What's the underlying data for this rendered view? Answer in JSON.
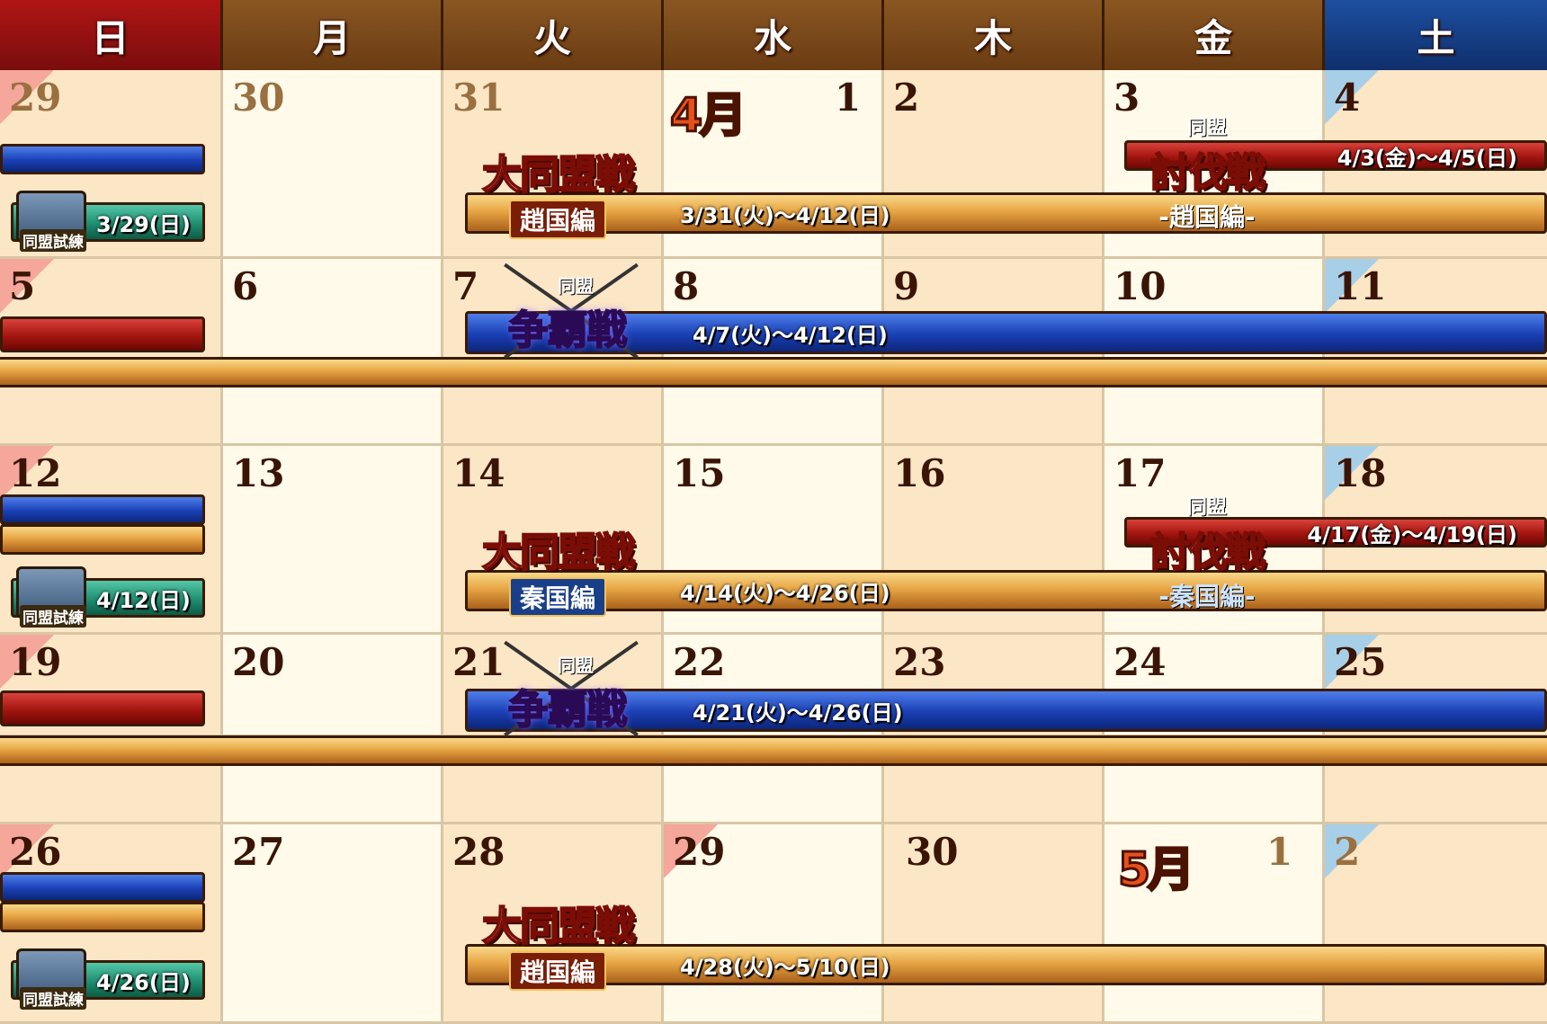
{
  "header": {
    "days": [
      "日",
      "月",
      "火",
      "水",
      "木",
      "金",
      "土"
    ]
  },
  "month_labels": {
    "april": "4月",
    "may": "5月"
  },
  "weeks": [
    {
      "dates": [
        "29",
        "30",
        "31",
        "1",
        "2",
        "3",
        "4"
      ]
    },
    {
      "dates": [
        "5",
        "6",
        "7",
        "8",
        "9",
        "10",
        "11"
      ]
    },
    {
      "dates": [
        "12",
        "13",
        "14",
        "15",
        "16",
        "17",
        "18"
      ]
    },
    {
      "dates": [
        "19",
        "20",
        "21",
        "22",
        "23",
        "24",
        "25"
      ]
    },
    {
      "dates": [
        "26",
        "27",
        "28",
        "29",
        "30",
        "1",
        "2"
      ]
    }
  ],
  "events": {
    "daidoumei_1": {
      "title": "大同盟戦",
      "sub": "趙国編",
      "dates": "3/31(火)～4/12(日)"
    },
    "daidoumei_2": {
      "title": "大同盟戦",
      "sub": "秦国編",
      "dates": "4/14(火)～4/26(日)"
    },
    "daidoumei_3": {
      "title": "大同盟戦",
      "sub": "趙国編",
      "dates": "4/28(火)～5/10(日)"
    },
    "toubatsu_1": {
      "top": "同盟",
      "title": "討伐戦",
      "sub": "-趙国編-",
      "dates": "4/3(金)～4/5(日)"
    },
    "toubatsu_2": {
      "top": "同盟",
      "title": "討伐戦",
      "sub": "-秦国編-",
      "dates": "4/17(金)～4/19(日)"
    },
    "souha_1": {
      "top": "同盟",
      "title": "争覇戦",
      "dates": "4/7(火)～4/12(日)"
    },
    "souha_2": {
      "top": "同盟",
      "title": "争覇戦",
      "dates": "4/21(火)～4/26(日)"
    },
    "shiren_1": {
      "label": "同盟試練",
      "dates": "3/29(日)"
    },
    "shiren_2": {
      "label": "同盟試練",
      "dates": "4/12(日)"
    },
    "shiren_3": {
      "label": "同盟試練",
      "dates": "4/26(日)"
    }
  },
  "colors": {
    "sunday": "#b01515",
    "saturday": "#1d4fa0",
    "weekday": "#8a5622",
    "blue_bar": "#1a3fb5",
    "red_bar": "#a3150f",
    "gold_bar": "#e8a544",
    "teal_bar": "#1f8e71"
  }
}
